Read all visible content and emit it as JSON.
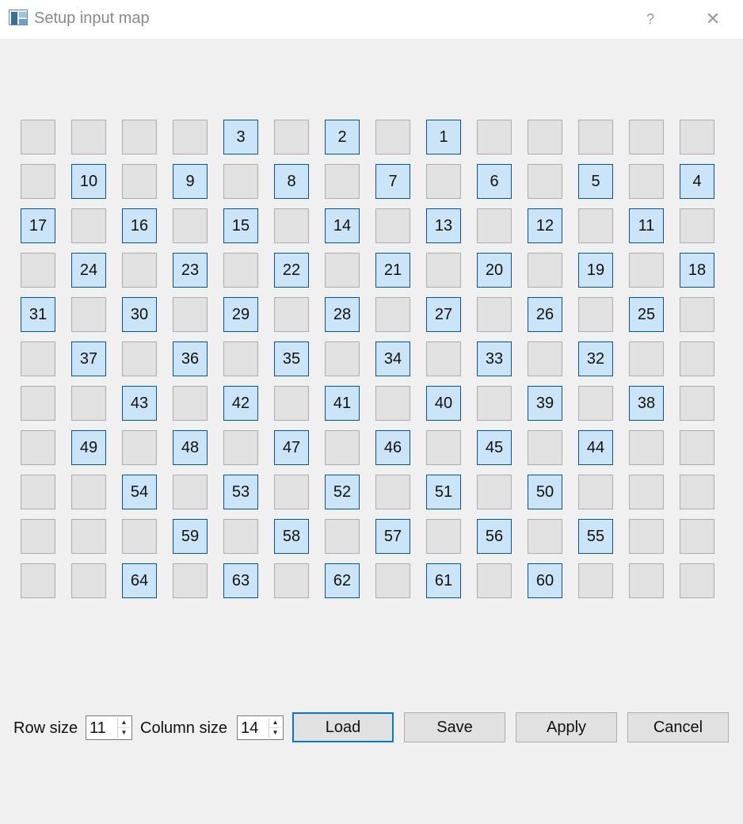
{
  "window": {
    "title": "Setup input map",
    "help_label": "?",
    "close_label": "✕",
    "app_icon": "grid-app-icon"
  },
  "colors": {
    "background": "#f0f0f0",
    "cell_inactive": "#e1e1e1",
    "cell_active": "#cce4f7",
    "cell_active_border": "#005499",
    "default_button_border": "#0078d7"
  },
  "grid": {
    "rows": 11,
    "columns": 14,
    "cells": [
      [
        "",
        "",
        "",
        "",
        "3",
        "",
        "2",
        "",
        "1",
        "",
        "",
        "",
        "",
        ""
      ],
      [
        "",
        "10",
        "",
        "9",
        "",
        "8",
        "",
        "7",
        "",
        "6",
        "",
        "5",
        "",
        "4"
      ],
      [
        "17",
        "",
        "16",
        "",
        "15",
        "",
        "14",
        "",
        "13",
        "",
        "12",
        "",
        "11",
        ""
      ],
      [
        "",
        "24",
        "",
        "23",
        "",
        "22",
        "",
        "21",
        "",
        "20",
        "",
        "19",
        "",
        "18"
      ],
      [
        "31",
        "",
        "30",
        "",
        "29",
        "",
        "28",
        "",
        "27",
        "",
        "26",
        "",
        "25",
        ""
      ],
      [
        "",
        "37",
        "",
        "36",
        "",
        "35",
        "",
        "34",
        "",
        "33",
        "",
        "32",
        "",
        ""
      ],
      [
        "",
        "",
        "43",
        "",
        "42",
        "",
        "41",
        "",
        "40",
        "",
        "39",
        "",
        "38",
        ""
      ],
      [
        "",
        "49",
        "",
        "48",
        "",
        "47",
        "",
        "46",
        "",
        "45",
        "",
        "44",
        "",
        ""
      ],
      [
        "",
        "",
        "54",
        "",
        "53",
        "",
        "52",
        "",
        "51",
        "",
        "50",
        "",
        "",
        ""
      ],
      [
        "",
        "",
        "",
        "59",
        "",
        "58",
        "",
        "57",
        "",
        "56",
        "",
        "55",
        "",
        ""
      ],
      [
        "",
        "",
        "64",
        "",
        "63",
        "",
        "62",
        "",
        "61",
        "",
        "60",
        "",
        "",
        ""
      ]
    ]
  },
  "controls": {
    "row_size_label": "Row size",
    "row_size_value": "11",
    "column_size_label": "Column size",
    "column_size_value": "14",
    "spin_up": "▲",
    "spin_down": "▼",
    "load_label": "Load",
    "save_label": "Save",
    "apply_label": "Apply",
    "cancel_label": "Cancel"
  }
}
